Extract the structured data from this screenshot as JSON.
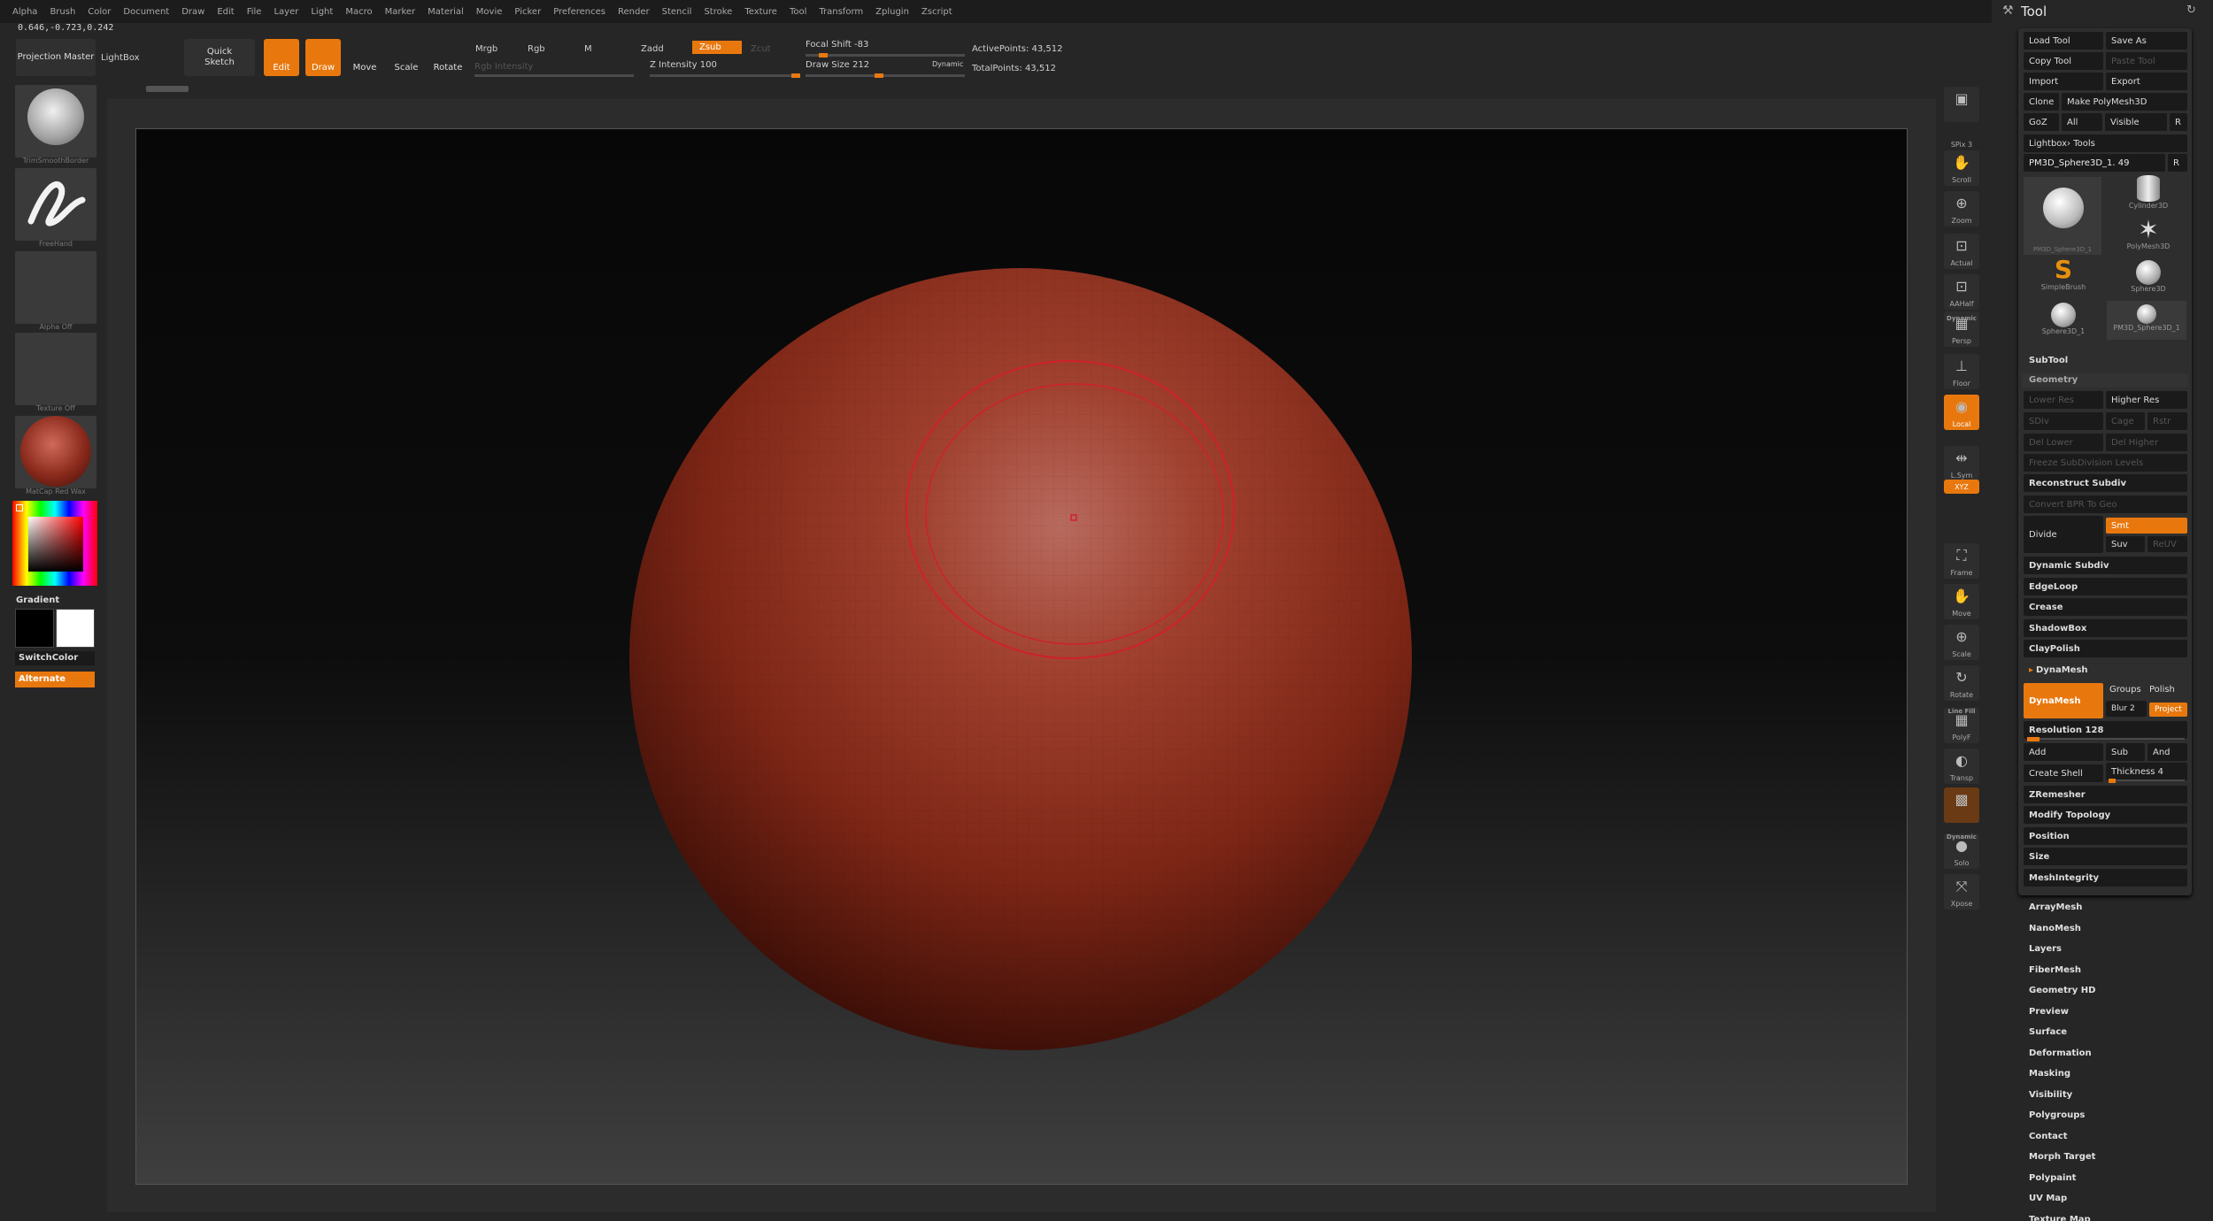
{
  "menu": [
    "Alpha",
    "Brush",
    "Color",
    "Document",
    "Draw",
    "Edit",
    "File",
    "Layer",
    "Light",
    "Macro",
    "Marker",
    "Material",
    "Movie",
    "Picker",
    "Preferences",
    "Render",
    "Stencil",
    "Stroke",
    "Texture",
    "Tool",
    "Transform",
    "Zplugin",
    "Zscript"
  ],
  "coords": "0.646,-0.723,0.242",
  "toolbar": {
    "projection_master": "Projection Master",
    "lightbox": "LightBox",
    "quick_sketch": "Quick Sketch",
    "edit": "Edit",
    "draw": "Draw",
    "move": "Move",
    "scale": "Scale",
    "rotate": "Rotate",
    "mrgb": "Mrgb",
    "rgb": "Rgb",
    "m": "M",
    "zadd": "Zadd",
    "zsub": "Zsub",
    "zcut": "Zcut",
    "rgb_intensity": "Rgb Intensity",
    "z_intensity": "Z Intensity 100",
    "focal_shift": "Focal Shift -83",
    "draw_size": "Draw Size 212",
    "dynamic": "Dynamic",
    "active_points": "ActivePoints: 43,512",
    "total_points": "TotalPoints: 43,512",
    "z_intensity_value": 1.0,
    "focal_shift_value": -0.83,
    "draw_size_value": 212
  },
  "left_shelf": {
    "brush": "TrimSmoothBorder",
    "stroke": "FreeHand",
    "alpha": "Alpha Off",
    "texture": "Texture Off",
    "material": "MatCap Red Wax",
    "gradient": "Gradient",
    "switch_color": "SwitchColor",
    "alternate": "Alternate"
  },
  "right_icons": [
    {
      "name": "bpr",
      "label": ""
    },
    {
      "name": "spix",
      "label": "SPix 3"
    },
    {
      "name": "scroll",
      "label": "Scroll"
    },
    {
      "name": "zoom",
      "label": "Zoom"
    },
    {
      "name": "actual",
      "label": "Actual"
    },
    {
      "name": "aahalf",
      "label": "AAHalf"
    },
    {
      "name": "persp",
      "label": "Persp"
    },
    {
      "name": "floor",
      "label": "Floor"
    },
    {
      "name": "local",
      "label": "Local"
    },
    {
      "name": "lsym",
      "label": "L.Sym"
    },
    {
      "name": "xyz",
      "label": "XYZ"
    },
    {
      "name": "frame",
      "label": "Frame"
    },
    {
      "name": "move",
      "label": "Move"
    },
    {
      "name": "scale",
      "label": "Scale"
    },
    {
      "name": "rotate",
      "label": "Rotate"
    },
    {
      "name": "polyf",
      "label": "PolyF"
    },
    {
      "name": "transp",
      "label": "Transp"
    },
    {
      "name": "ghost",
      "label": ""
    },
    {
      "name": "solo",
      "label": "Solo"
    },
    {
      "name": "xpose",
      "label": "Xpose"
    }
  ],
  "right_icon_extra": {
    "dynamic": "Dynamic",
    "line_fill": "Line Fill",
    "dynamic2": "Dynamic"
  },
  "tool": {
    "title": "Tool",
    "load_tool": "Load Tool",
    "save_as": "Save As",
    "copy_tool": "Copy Tool",
    "paste_tool": "Paste Tool",
    "import": "Import",
    "export": "Export",
    "clone": "Clone",
    "make_polymesh": "Make PolyMesh3D",
    "goz": "GoZ",
    "all": "All",
    "visible": "Visible",
    "r": "R",
    "lightbox_tools": "Lightbox› Tools",
    "current_tool": "PM3D_Sphere3D_1. 49",
    "thumbs": [
      "PM3D_Sphere3D_1",
      "Cylinder3D",
      "PolyMesh3D",
      "SimpleBrush",
      "Sphere3D",
      "Sphere3D_1",
      "PM3D_Sphere3D_1"
    ]
  },
  "subtool": {
    "subtool": "SubTool",
    "geometry": "Geometry",
    "lower_res": "Lower Res",
    "higher_res": "Higher Res",
    "sdiv": "SDiv",
    "cage": "Cage",
    "rstr": "Rstr",
    "del_lower": "Del Lower",
    "del_higher": "Del Higher",
    "freeze": "Freeze SubDivision Levels",
    "reconstruct": "Reconstruct Subdiv",
    "convert_bpr": "Convert BPR To Geo",
    "divide": "Divide",
    "smt": "Smt",
    "suv": "Suv",
    "reuv": "ReUV",
    "dynamic_subdiv": "Dynamic Subdiv",
    "edgeloop": "EdgeLoop",
    "crease": "Crease",
    "shadowbox": "ShadowBox",
    "claypolish": "ClayPolish",
    "dynamesh_head": "DynaMesh",
    "dynamesh_btn": "DynaMesh",
    "groups": "Groups",
    "polish": "Polish",
    "blur": "Blur 2",
    "project": "Project",
    "resolution": "Resolution 128",
    "add": "Add",
    "sub": "Sub",
    "and": "And",
    "create_shell": "Create Shell",
    "thickness": "Thickness 4",
    "zremesher": "ZRemesher",
    "modify_topology": "Modify Topology",
    "position": "Position",
    "size": "Size",
    "meshintegrity": "MeshIntegrity"
  },
  "sections": [
    "ArrayMesh",
    "NanoMesh",
    "Layers",
    "FiberMesh",
    "Geometry HD",
    "Preview",
    "Surface",
    "Deformation",
    "Masking",
    "Visibility",
    "Polygroups",
    "Contact",
    "Morph Target",
    "Polypaint",
    "UV Map",
    "Texture Map"
  ],
  "colors": {
    "accent": "#e8780e",
    "sphere": "#9a3320",
    "brush_ring": "#d0202a"
  }
}
